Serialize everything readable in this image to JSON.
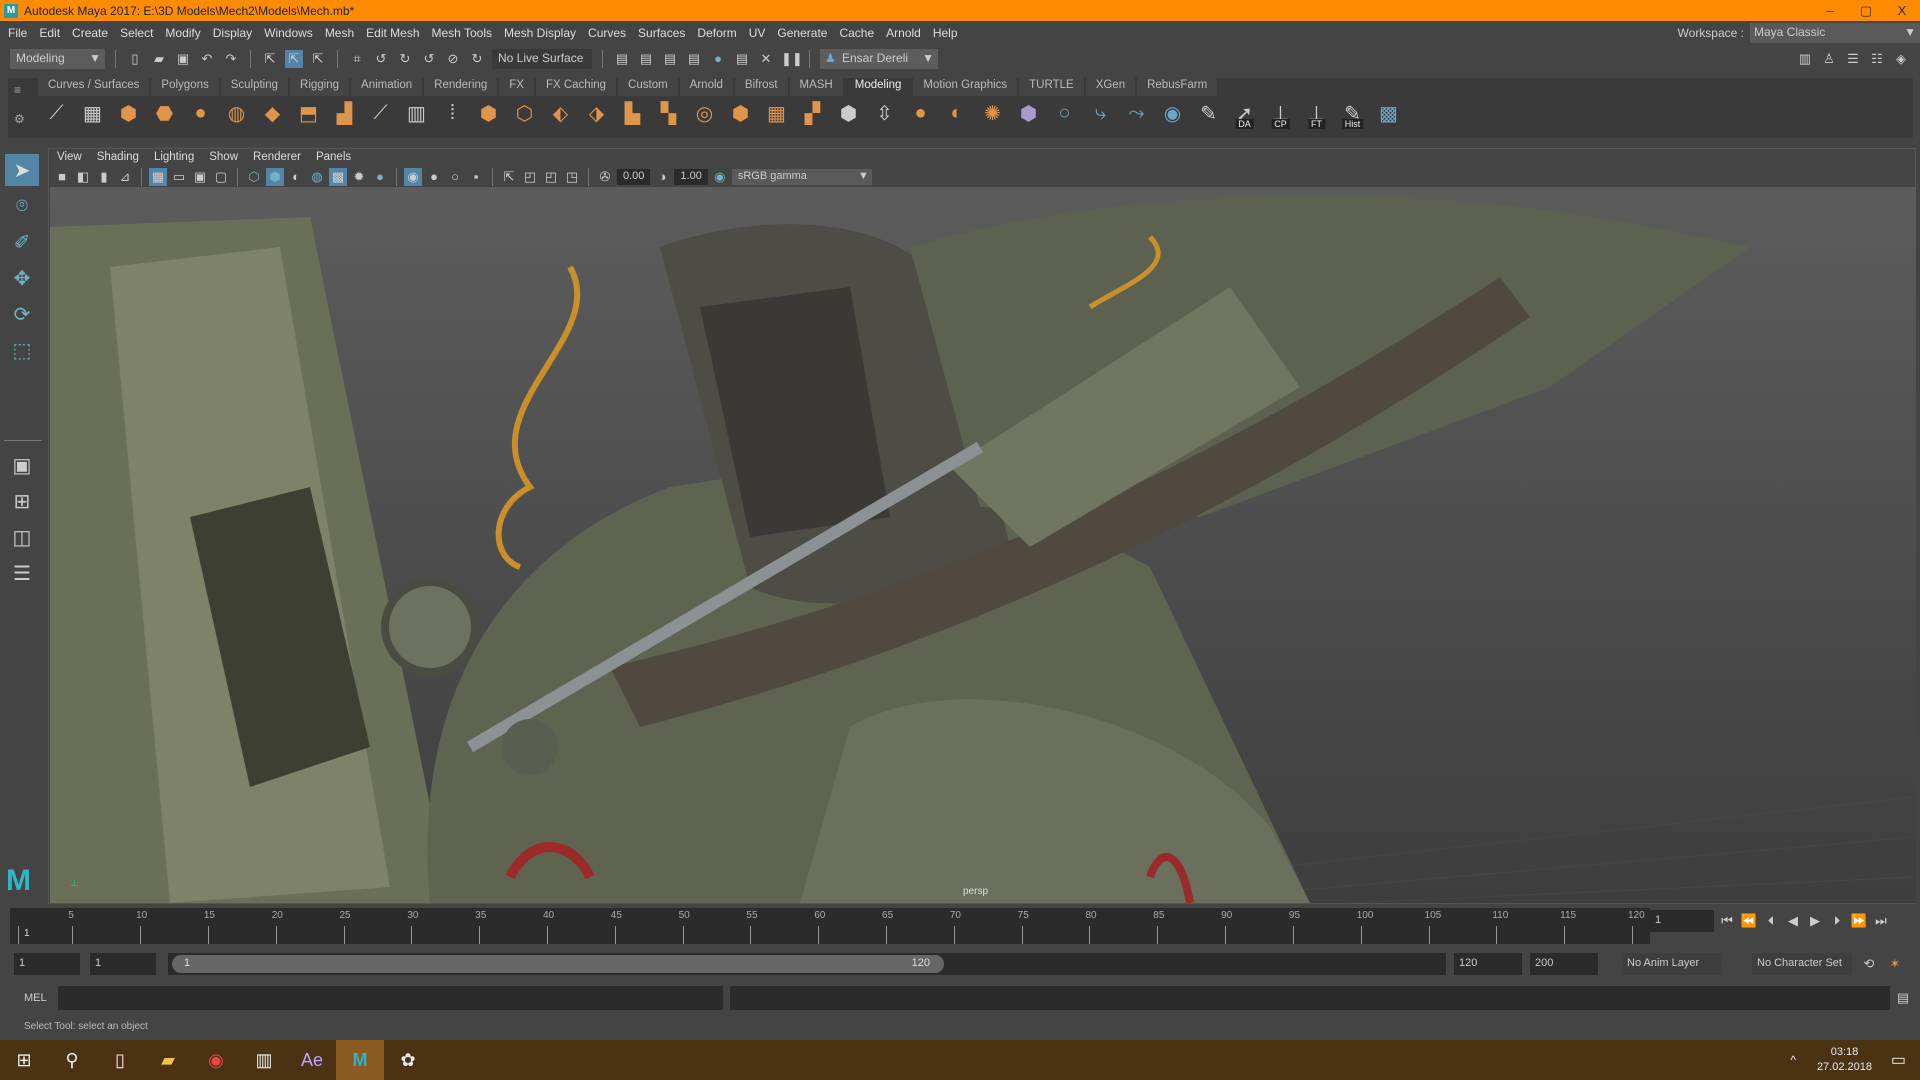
{
  "window": {
    "title": "Autodesk Maya 2017: E:\\3D Models\\Mech2\\Models\\Mech.mb*",
    "minimize": "–",
    "maximize": "▢",
    "close": "X"
  },
  "menu": [
    "File",
    "Edit",
    "Create",
    "Select",
    "Modify",
    "Display",
    "Windows",
    "Mesh",
    "Edit Mesh",
    "Mesh Tools",
    "Mesh Display",
    "Curves",
    "Surfaces",
    "Deform",
    "UV",
    "Generate",
    "Cache",
    "Arnold",
    "Help"
  ],
  "workspace": {
    "label": "Workspace :",
    "value": "Maya Classic"
  },
  "statusline": {
    "mode": "Modeling",
    "live_surface": "No Live Surface",
    "user": "Ensar Dereli"
  },
  "shelf": {
    "tabs": [
      "Curves / Surfaces",
      "Polygons",
      "Sculpting",
      "Rigging",
      "Animation",
      "Rendering",
      "FX",
      "FX Caching",
      "Custom",
      "Arnold",
      "Bifrost",
      "MASH",
      "Modeling",
      "Motion Graphics",
      "TURTLE",
      "XGen",
      "RebusFarm"
    ],
    "active_tab": "Modeling",
    "icons": [
      [
        "multi-cut-icon",
        "⟋",
        "w"
      ],
      [
        "grid-icon",
        "▦",
        "w"
      ],
      [
        "poly-cube-icon",
        "⬢",
        ""
      ],
      [
        "poly-cylinder-icon",
        "⬣",
        ""
      ],
      [
        "poly-sphere-icon",
        "●",
        ""
      ],
      [
        "poly-torus-icon",
        "◍",
        ""
      ],
      [
        "poly-plane-icon",
        "◆",
        ""
      ],
      [
        "extrude-icon",
        "⬒",
        ""
      ],
      [
        "bridge-icon",
        "▟",
        ""
      ],
      [
        "bevel-icon",
        "⟋",
        "w"
      ],
      [
        "insert-edgeloop-icon",
        "▥",
        "w"
      ],
      [
        "detach-icon",
        "⁞",
        "w"
      ],
      [
        "combine-icon",
        "⬢",
        ""
      ],
      [
        "separate-icon",
        "⬡",
        ""
      ],
      [
        "merge-icon",
        "⬖",
        ""
      ],
      [
        "target-weld-icon",
        "⬗",
        ""
      ],
      [
        "smooth-icon",
        "▙",
        ""
      ],
      [
        "fill-hole-icon",
        "▚",
        ""
      ],
      [
        "quad-draw-icon",
        "◎",
        ""
      ],
      [
        "triangulate-icon",
        "⬢",
        ""
      ],
      [
        "quadrangulate-icon",
        "▦",
        ""
      ],
      [
        "mirror-icon",
        "▞",
        ""
      ],
      [
        "boolean-icon",
        "⬢",
        "w"
      ],
      [
        "uv-icon",
        "⇳",
        "w"
      ],
      [
        "sphere-uv-icon",
        "●",
        ""
      ],
      [
        "soft-icon",
        "◐",
        ""
      ],
      [
        "sculpt-icon",
        "✺",
        ""
      ],
      [
        "lattice-icon",
        "⬢",
        "p"
      ],
      [
        "circle-icon",
        "○",
        "b"
      ],
      [
        "curve-icon",
        "⤷",
        "b"
      ],
      [
        "curve2-icon",
        "⤳",
        "b"
      ],
      [
        "tube-icon",
        "◉",
        "b"
      ],
      [
        "paint-icon",
        "✎",
        "w"
      ],
      [
        "da-icon",
        "➚",
        "w",
        "DA"
      ],
      [
        "cp-icon",
        "⊥",
        "w",
        "CP"
      ],
      [
        "ft-icon",
        "⊥",
        "w",
        "FT"
      ],
      [
        "hist-icon",
        "✎",
        "w",
        "Hist"
      ],
      [
        "checker-icon",
        "▩",
        "b"
      ]
    ]
  },
  "toolbox": [
    "select-tool-icon",
    "lasso-tool-icon",
    "paint-select-icon",
    "move-tool-icon",
    "rotate-tool-icon",
    "scale-tool-icon"
  ],
  "panel": {
    "menu": [
      "View",
      "Shading",
      "Lighting",
      "Show",
      "Renderer",
      "Panels"
    ],
    "exposure": "0.00",
    "gamma": "1.00",
    "color_space": "sRGB gamma",
    "camera": "persp"
  },
  "timeline": {
    "start": 1,
    "end": 120,
    "labels": [
      "5",
      "10",
      "15",
      "20",
      "25",
      "30",
      "35",
      "40",
      "45",
      "50",
      "55",
      "60",
      "65",
      "70",
      "75",
      "80",
      "85",
      "90",
      "95",
      "100",
      "105",
      "110",
      "115",
      "120"
    ],
    "current": "1",
    "current_frame_field": "1"
  },
  "range": {
    "start": "1",
    "anim_start": "1",
    "range_start": "1",
    "range_end": "120",
    "end": "120",
    "anim_end": "200",
    "anim_layer": "No Anim Layer",
    "char_set": "No Character Set"
  },
  "cmd": {
    "label": "MEL"
  },
  "help": "Select Tool: select an object",
  "taskbar": {
    "time": "03:18",
    "date": "27.02.2018"
  }
}
